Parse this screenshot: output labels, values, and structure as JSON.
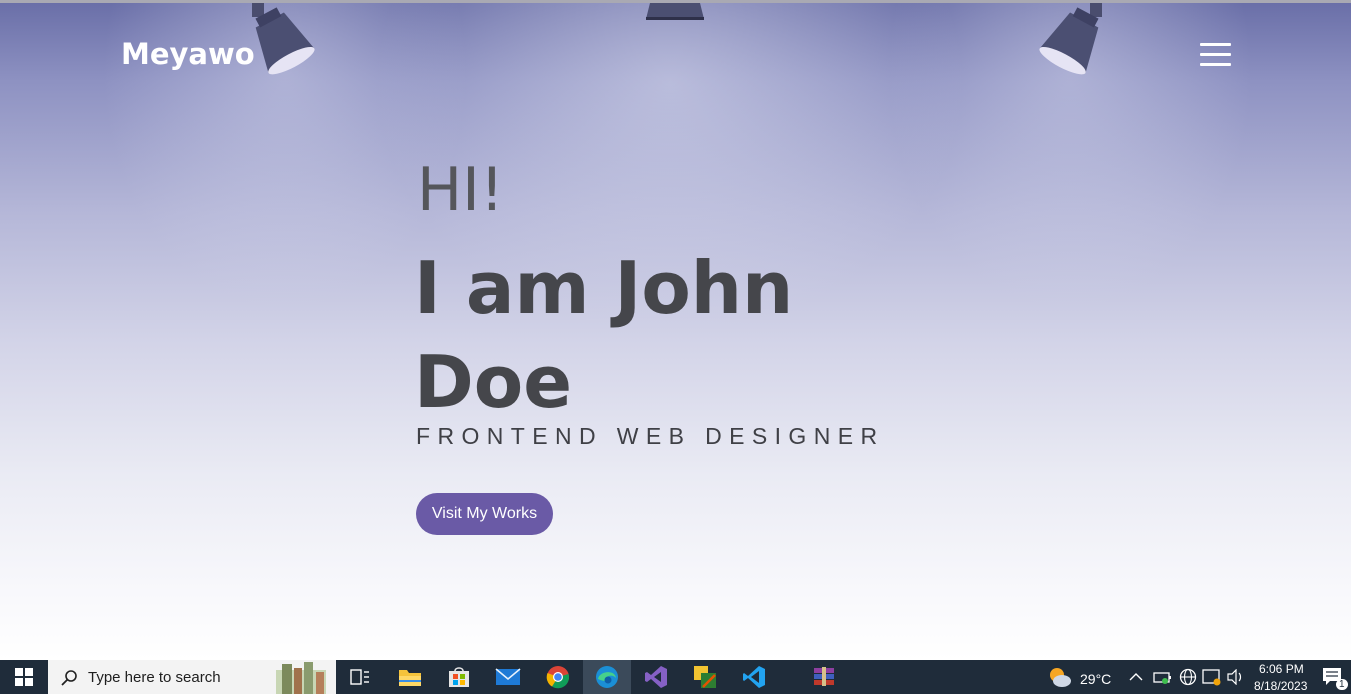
{
  "site": {
    "brand": "Meyawo",
    "greeting": "HI!",
    "name_line1": "I am John",
    "name_line2": "Doe",
    "role": "FRONTEND WEB DESIGNER",
    "cta_label": "Visit My Works"
  },
  "taskbar": {
    "search_placeholder": "Type here to search",
    "temperature": "29°C",
    "time": "6:06 PM",
    "date": "8/18/2023",
    "notification_count": "1",
    "apps": [
      "task-view",
      "file-explorer",
      "microsoft-store",
      "mail",
      "chrome",
      "edge",
      "visual-studio",
      "paint-tool",
      "vs-code",
      "winrar"
    ]
  },
  "colors": {
    "accent": "#6a5aa6",
    "heading": "#45464b",
    "taskbar": "#1f2c3a"
  }
}
